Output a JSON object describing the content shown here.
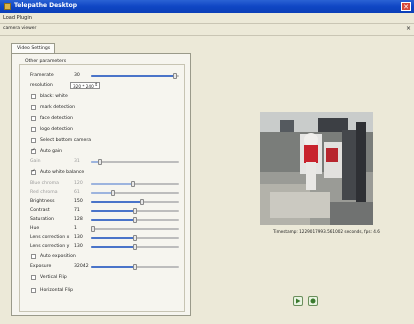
{
  "window": {
    "title": "Telepathe Desktop",
    "close_icon": "close-icon"
  },
  "menu": {
    "load_plugin": "Load Plugin"
  },
  "toolbar": {
    "plugin_label": "camera viewer"
  },
  "tab": {
    "label": "Video Settings"
  },
  "group": {
    "title": "Other parameters"
  },
  "settings": {
    "framerate": {
      "label": "Framerate",
      "value": "30",
      "fraction": 0.96
    },
    "resolution": {
      "label": "resolution",
      "value": "320 * 240"
    },
    "black_white": {
      "label": "black: white",
      "checked": false
    },
    "mark_detection": {
      "label": "mark detection",
      "checked": false
    },
    "face_detection": {
      "label": "face detection",
      "checked": false
    },
    "logo_detection": {
      "label": "logo detection",
      "checked": false
    },
    "select_bottom_camera": {
      "label": "Select bottom camera",
      "checked": false
    },
    "auto_gain": {
      "label": "Auto gain",
      "checked": true
    },
    "gain": {
      "label": "Gain",
      "value": "31",
      "fraction": 0.1
    },
    "auto_white_balance": {
      "label": "Auto white balance",
      "checked": true
    },
    "blue_chroma": {
      "label": "Blue chroma",
      "value": "120",
      "fraction": 0.48
    },
    "red_chroma": {
      "label": "Red chroma",
      "value": "61",
      "fraction": 0.25
    },
    "brightness": {
      "label": "Brightness",
      "value": "150",
      "fraction": 0.58
    },
    "contrast": {
      "label": "Contrast",
      "value": "71",
      "fraction": 0.5
    },
    "saturation": {
      "label": "Saturation",
      "value": "128",
      "fraction": 0.5
    },
    "hue": {
      "label": "Hue",
      "value": "1",
      "fraction": 0.02
    },
    "lens_correction_x": {
      "label": "Lens correction x",
      "value": "130",
      "fraction": 0.5
    },
    "lens_correction_y": {
      "label": "Lens correction y",
      "value": "130",
      "fraction": 0.5
    },
    "auto_exposition": {
      "label": "Auto exposition",
      "checked": false
    },
    "exposure": {
      "label": "Exposure",
      "value": "32042",
      "fraction": 0.5
    },
    "vertical_flip": {
      "label": "Vertical Flip",
      "checked": false
    },
    "horizontal_flip": {
      "label": "Horizontal Flip",
      "checked": false
    }
  },
  "camera": {
    "timestamp": "Timestamp: 1229017993.561002 seconds, fps: 4.6"
  },
  "colors": {
    "title_blue": "#0f46c4",
    "slider_blue": "#4a74c9",
    "window_bg": "#ece9d8"
  },
  "buttons": {
    "play": "play-icon",
    "record": "record-icon"
  }
}
